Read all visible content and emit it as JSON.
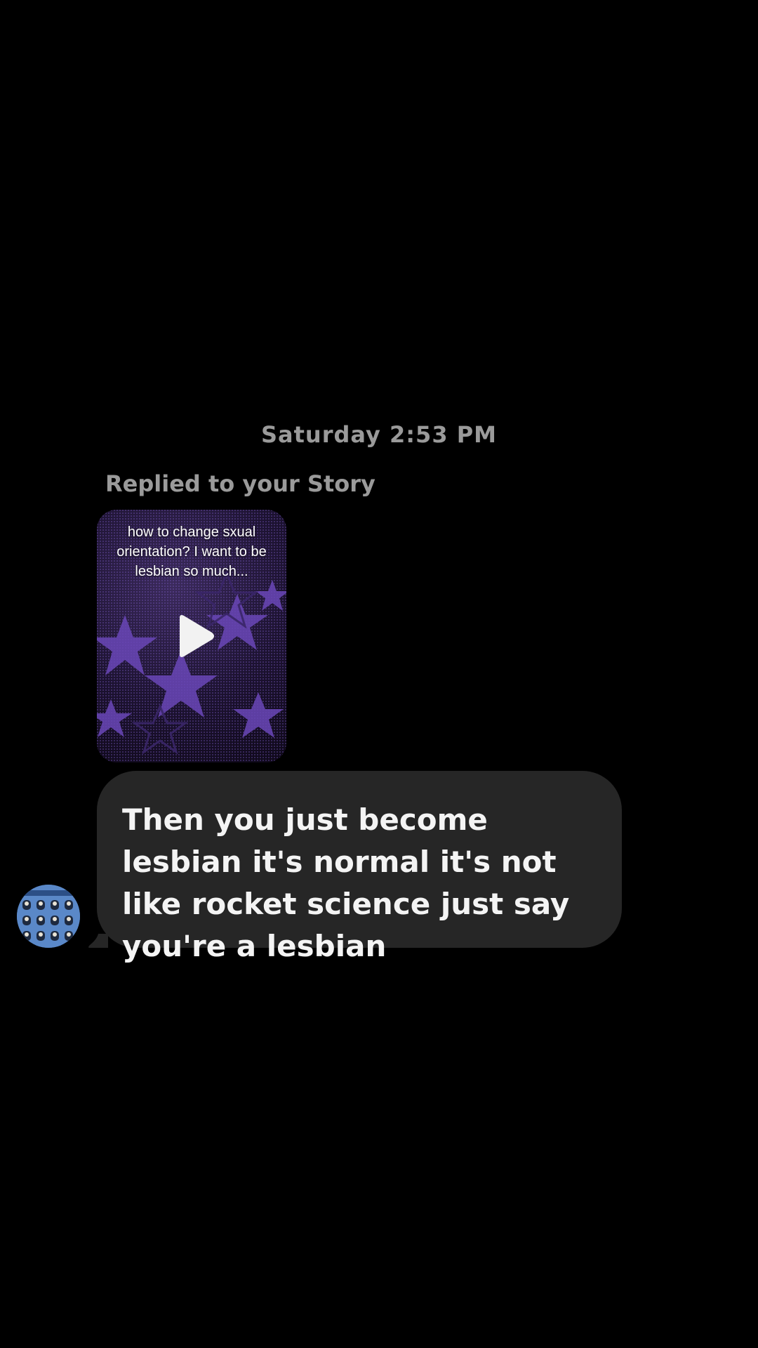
{
  "timestamp": "Saturday 2:53 PM",
  "reply_label": "Replied to your Story",
  "story": {
    "caption": "how to change sxual orientation? I want to be lesbian so much...",
    "icon": "play-icon"
  },
  "message": {
    "text": "Then you just become lesbian it's normal it's not like rocket science just say you're a lesbian"
  },
  "avatar": {
    "icon": "avatar"
  },
  "colors": {
    "background": "#000000",
    "bubble": "#262626",
    "meta_text": "#9a9a9a",
    "message_text": "#f4f4f4",
    "story_accent": "#5b3f96"
  }
}
